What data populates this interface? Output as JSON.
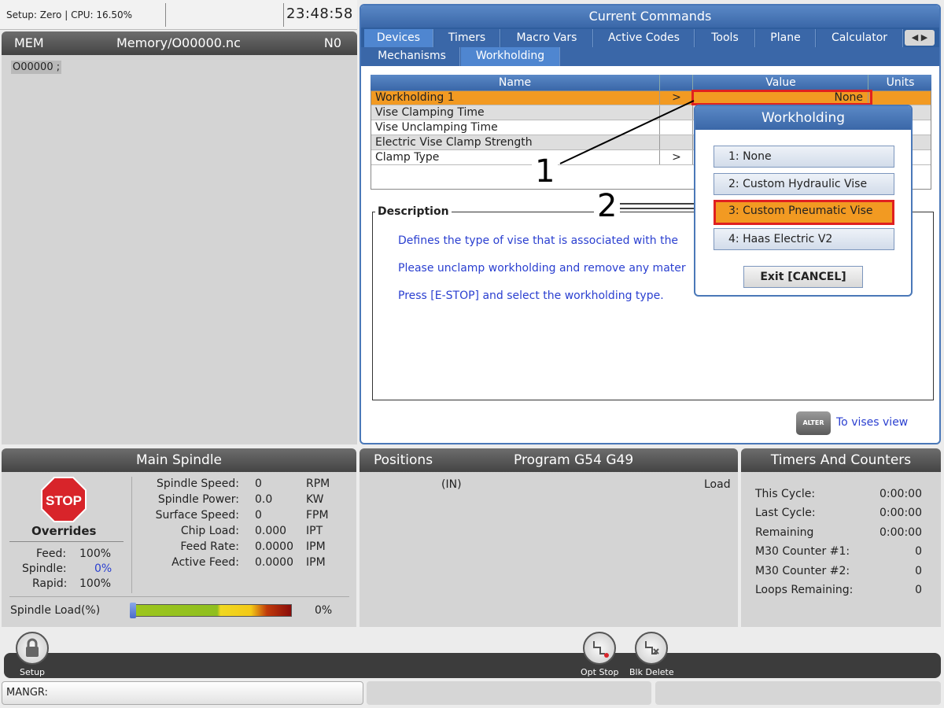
{
  "status": {
    "text": "Setup: Zero | CPU: 16.50%",
    "clock": "23:48:58"
  },
  "memory": {
    "mode": "MEM",
    "file": "Memory/O00000.nc",
    "n": "N0",
    "line": "O00000 ;"
  },
  "current_commands": {
    "title": "Current Commands",
    "tabs": [
      "Devices",
      "Timers",
      "Macro Vars",
      "Active Codes",
      "Tools",
      "Plane",
      "Calculator"
    ],
    "subtabs": [
      "Mechanisms",
      "Workholding"
    ],
    "table": {
      "headers": {
        "name": "Name",
        "value": "Value",
        "units": "Units"
      },
      "rows": [
        {
          "name": "Workholding 1",
          "arrow": ">",
          "value": "None"
        },
        {
          "name": "Vise Clamping Time",
          "arrow": "",
          "value": ""
        },
        {
          "name": "Vise Unclamping Time",
          "arrow": "",
          "value": ""
        },
        {
          "name": "Electric Vise Clamp Strength",
          "arrow": "",
          "value": ""
        },
        {
          "name": "Clamp Type",
          "arrow": ">",
          "value": ""
        }
      ]
    },
    "description": {
      "label": "Description",
      "lines": [
        "Defines the type of vise that is associated with the",
        "Please unclamp workholding and remove any mater",
        "Press [E-STOP] and select the workholding type."
      ]
    },
    "alter_key": "ALTER",
    "alter_text": "To vises view"
  },
  "popup": {
    "title": "Workholding",
    "options": [
      "1: None",
      "2: Custom Hydraulic Vise",
      "3: Custom Pneumatic Vise",
      "4: Haas Electric V2"
    ],
    "exit": "Exit  [CANCEL]"
  },
  "callouts": {
    "one": "1",
    "two": "2"
  },
  "main_spindle": {
    "title": "Main Spindle",
    "stop_label": "STOP",
    "overrides_title": "Overrides",
    "overrides": [
      {
        "label": "Feed:",
        "value": "100%"
      },
      {
        "label": "Spindle:",
        "value": "0%"
      },
      {
        "label": "Rapid:",
        "value": "100%"
      }
    ],
    "readouts": [
      {
        "label": "Spindle Speed:",
        "value": "0",
        "unit": "RPM"
      },
      {
        "label": "Spindle Power:",
        "value": "0.0",
        "unit": "KW"
      },
      {
        "label": "Surface Speed:",
        "value": "0",
        "unit": "FPM"
      },
      {
        "label": "Chip Load:",
        "value": "0.000",
        "unit": "IPT"
      },
      {
        "label": "Feed Rate:",
        "value": "0.0000",
        "unit": "IPM"
      },
      {
        "label": "Active Feed:",
        "value": "0.0000",
        "unit": "IPM"
      }
    ],
    "load_label": "Spindle Load(%)",
    "load_value": "0%",
    "load_fraction": 0
  },
  "positions": {
    "title": "Positions",
    "program": "Program G54 G49",
    "unit": "(IN)",
    "load": "Load"
  },
  "timers": {
    "title": "Timers And Counters",
    "rows": [
      {
        "label": "This Cycle:",
        "value": "0:00:00"
      },
      {
        "label": "Last Cycle:",
        "value": "0:00:00"
      },
      {
        "label": "Remaining",
        "value": "0:00:00"
      },
      {
        "label": "M30 Counter #1:",
        "value": "0"
      },
      {
        "label": "M30 Counter #2:",
        "value": "0"
      },
      {
        "label": "Loops Remaining:",
        "value": "0"
      }
    ]
  },
  "toolbar": {
    "setup": "Setup",
    "opt_stop": "Opt Stop",
    "blk_delete": "Blk Delete"
  },
  "input": {
    "text": "MANGR:"
  },
  "colors": {
    "accent_blue": "#3a67a8",
    "highlight_orange": "#f29a22",
    "callout_red": "#e02020"
  }
}
